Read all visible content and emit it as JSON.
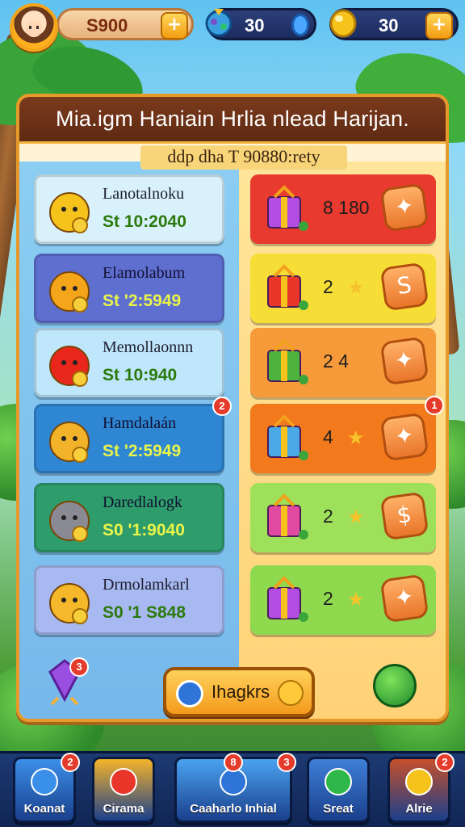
{
  "hud": {
    "coins": "S900",
    "gems": "30",
    "energy": "30",
    "plus": "+"
  },
  "board": {
    "title": "Mia.igm Haniain Hrlia nlead Harijan.",
    "subtitle": "ddp dha T 90880:rety"
  },
  "players": [
    {
      "name": "Lanotalnoku",
      "value": "St 10:2040",
      "color": "#d8f1fb",
      "dark": false
    },
    {
      "name": "Elamolabum",
      "value": "St '2:5949",
      "color": "#5f6fd0",
      "dark": true
    },
    {
      "name": "Memollaonnn",
      "value": "St 10:940",
      "color": "#bfe6fb",
      "dark": false
    },
    {
      "name": "Hamdalaán",
      "value": "St '2:5949",
      "color": "#2f86d2",
      "dark": true,
      "badge": "2"
    },
    {
      "name": "Daredlalogk",
      "value": "S0 '1:9040",
      "color": "#2e9c6b",
      "dark": true
    },
    {
      "name": "Drmolamkarl",
      "value": "S0 '1 S848",
      "color": "#a7b9f0",
      "dark": false
    }
  ],
  "rewards": [
    {
      "text": "8 180",
      "color": "#e83a2e",
      "star": false,
      "button": "✦"
    },
    {
      "text": "2",
      "color": "#f7de36",
      "star": true,
      "button": "S"
    },
    {
      "text": "2  4",
      "color": "#f69a3a",
      "star": false,
      "button": "✦"
    },
    {
      "text": "4",
      "color": "#f37a1c",
      "star": true,
      "button": "✦",
      "badge": "1"
    },
    {
      "text": "2",
      "color": "#9ee05a",
      "star": true,
      "button": "$"
    },
    {
      "text": "2",
      "color": "#8fd94e",
      "star": true,
      "button": "✦"
    }
  ],
  "actions": {
    "get_label": "Ihagkrs",
    "gem_badge": "3"
  },
  "nav": [
    {
      "label": "Koanat",
      "color": "#3b8fe8",
      "badge": "2"
    },
    {
      "label": "Cirama",
      "color": "#f5b42a",
      "badge": ""
    },
    {
      "label": "Caaharlo Inhial",
      "color": "#4aa3f0",
      "badge": "3",
      "badge2": "8"
    },
    {
      "label": "Sreat",
      "color": "#3f7fd8",
      "badge": ""
    },
    {
      "label": "Alrie",
      "color": "#c6502a",
      "badge": "2"
    }
  ]
}
